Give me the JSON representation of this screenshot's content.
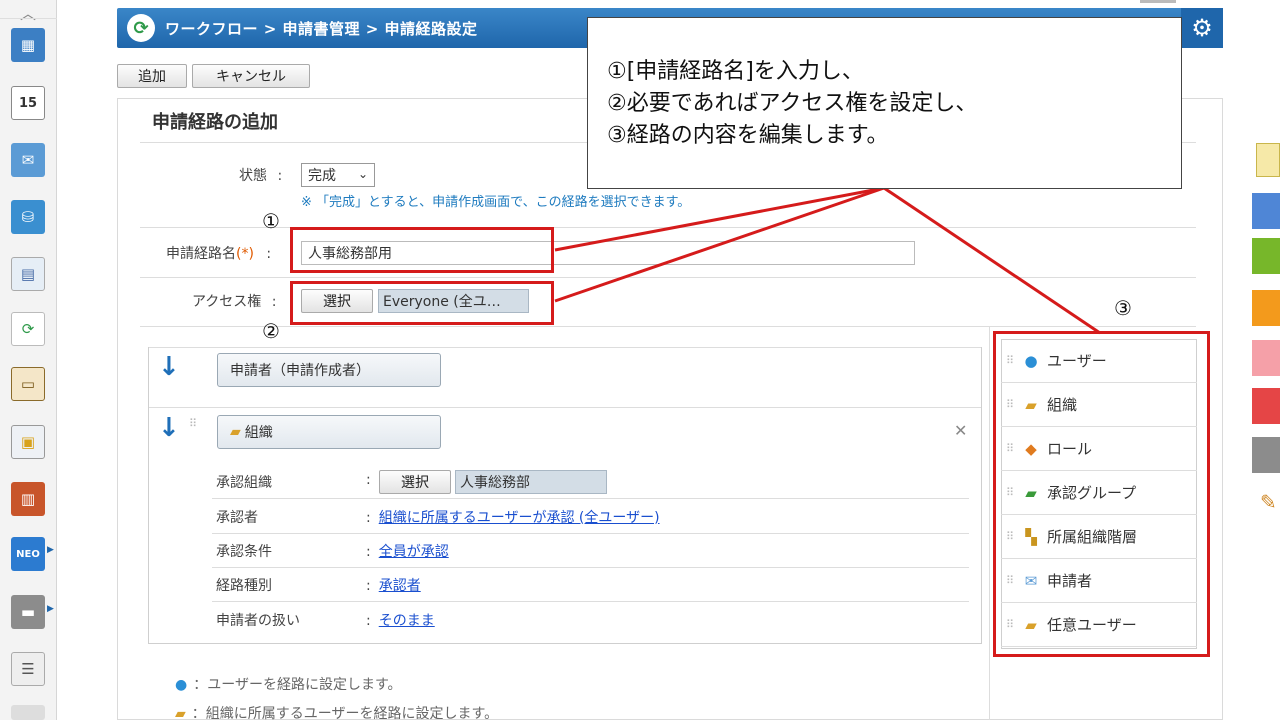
{
  "header": {
    "breadcrumb": "ワークフロー > 申請書管理 > 申請経路設定"
  },
  "toolbar": {
    "add_label": "追加",
    "cancel_label": "キャンセル"
  },
  "page": {
    "title": "申請経路の追加"
  },
  "form": {
    "status_label": "状態",
    "status_value": "完成",
    "status_note": "※ 「完成」とすると、申請作成画面で、この経路を選択できます。",
    "route_name_label": "申請経路名",
    "route_name_required": "(*)",
    "route_name_value": "人事総務部用",
    "access_label": "アクセス権",
    "access_select": "選択",
    "access_value": "Everyone (全ユ…",
    "colon": ":"
  },
  "route": {
    "first_step": "申請者（申請作成者）",
    "second_step": "組織",
    "props": [
      {
        "label": "承認組織",
        "select": "選択",
        "value": "人事総務部"
      },
      {
        "label": "承認者",
        "value": "組織に所属するユーザーが承認 (全ユーザー)"
      },
      {
        "label": "承認条件",
        "value": "全員が承認"
      },
      {
        "label": "経路種別",
        "value": "承認者"
      },
      {
        "label": "申請者の扱い",
        "value": "そのまま"
      }
    ]
  },
  "palette": {
    "items": [
      {
        "label": "ユーザー",
        "icon": "user-icon"
      },
      {
        "label": "組織",
        "icon": "organization-icon"
      },
      {
        "label": "ロール",
        "icon": "role-icon"
      },
      {
        "label": "承認グループ",
        "icon": "approval-group-icon"
      },
      {
        "label": "所属組織階層",
        "icon": "org-hierarchy-icon"
      },
      {
        "label": "申請者",
        "icon": "applicant-icon"
      },
      {
        "label": "任意ユーザー",
        "icon": "any-user-icon"
      }
    ]
  },
  "legend": [
    "：ユーザーを経路に設定します。",
    "：組織に所属するユーザーを経路に設定します。"
  ],
  "annotation": {
    "lines": [
      "①[申請経路名]を入力し、",
      "②必要であればアクセス権を設定し、",
      "③経路の内容を編集します。"
    ],
    "num1": "①",
    "num2": "②",
    "num3": "③"
  },
  "colors": {
    "header": "#1f66ab",
    "highlight": "#d51b1b",
    "link": "#1a4fcf"
  }
}
